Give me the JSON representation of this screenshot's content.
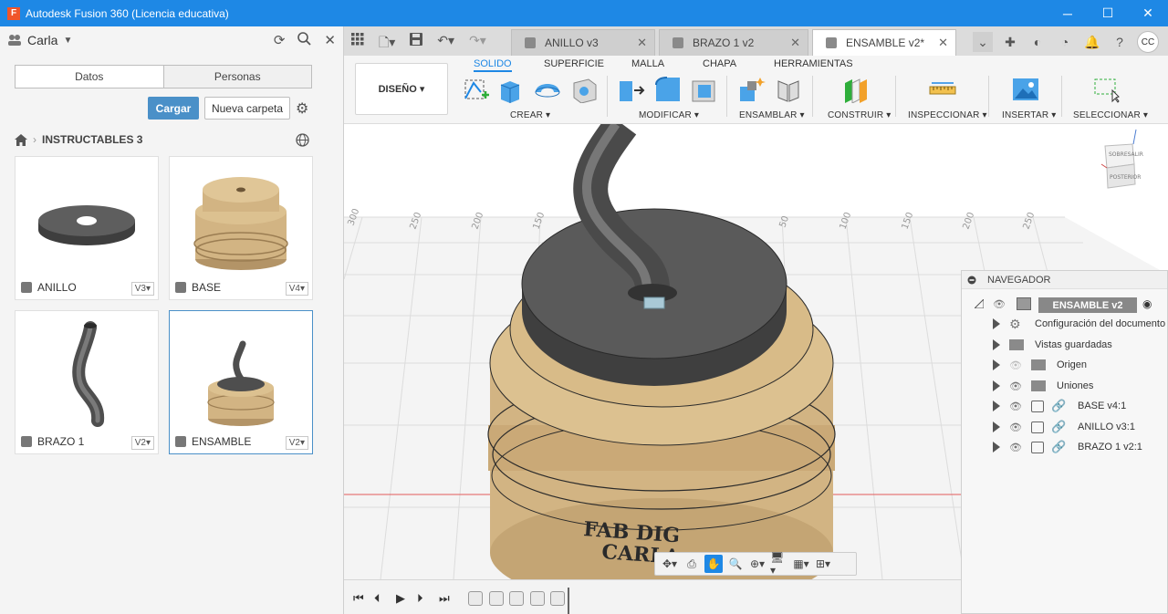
{
  "window": {
    "title": "Autodesk Fusion 360 (Licencia educativa)",
    "logo": "F",
    "controls": {
      "minimize": "─",
      "maximize": "☐",
      "close": "✕"
    }
  },
  "data_panel": {
    "user": "Carla",
    "tabs": [
      "Datos",
      "Personas"
    ],
    "upload_label": "Cargar",
    "new_folder_label": "Nueva carpeta",
    "breadcrumb": {
      "folder": "INSTRUCTABLES 3"
    },
    "files": [
      {
        "name": "ANILLO",
        "version": "V3▾"
      },
      {
        "name": "BASE",
        "version": "V4▾"
      },
      {
        "name": "BRAZO 1",
        "version": "V2▾"
      },
      {
        "name": "ENSAMBLE",
        "version": "V2▾"
      }
    ]
  },
  "doc_tabs": [
    {
      "label": "ANILLO v3"
    },
    {
      "label": "BRAZO 1 v2"
    },
    {
      "label": "ENSAMBLE v2*"
    }
  ],
  "user_initials": "CC",
  "ribbon": {
    "workspace": "DISEÑO ▾",
    "tabs": [
      "SOLIDO",
      "SUPERFICIE",
      "MALLA",
      "CHAPA",
      "HERRAMIENTAS"
    ],
    "groups": [
      "CREAR ▾",
      "MODIFICAR ▾",
      "ENSAMBLAR ▾",
      "CONSTRUIR ▾",
      "INSPECCIONAR ▾",
      "INSERTAR ▾",
      "SELECCIONAR ▾"
    ]
  },
  "viewcube": {
    "top_label": "SOBRESALIR",
    "front_label": "POSTERIOR"
  },
  "grid_ticks": [
    "300",
    "250",
    "200",
    "150",
    "50",
    "100",
    "150",
    "200",
    "250"
  ],
  "model_text": {
    "line1": "FAB DIG",
    "line2": "CARLA"
  },
  "navigator": {
    "title": "NAVEGADOR",
    "root": "ENSAMBLE v2",
    "items": [
      {
        "label": "Configuración del documento"
      },
      {
        "label": "Vistas guardadas"
      },
      {
        "label": "Origen"
      },
      {
        "label": "Uniones"
      },
      {
        "label": "BASE v4:1"
      },
      {
        "label": "ANILLO v3:1"
      },
      {
        "label": "BRAZO 1 v2:1"
      }
    ]
  },
  "colors": {
    "accent": "#1e88e5",
    "primary_button": "#4a90c8",
    "base_tan": "#d2b483",
    "ring_dark": "#5a5a5a"
  }
}
